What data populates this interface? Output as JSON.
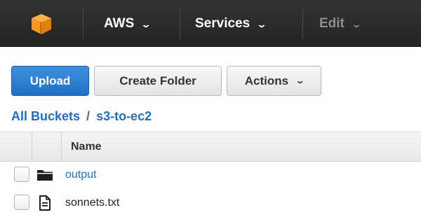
{
  "nav": {
    "logo_icon": "aws-cube-icon",
    "items": [
      {
        "label": "AWS",
        "caret": "⌄"
      },
      {
        "label": "Services",
        "caret": "⌄"
      },
      {
        "label": "Edit",
        "caret": "⌄",
        "disabled": true
      }
    ]
  },
  "toolbar": {
    "upload_label": "Upload",
    "create_folder_label": "Create Folder",
    "actions_label": "Actions",
    "actions_caret": "⌄"
  },
  "breadcrumb": {
    "root": "All Buckets",
    "separator": "/",
    "current": "s3-to-ec2"
  },
  "table": {
    "name_header": "Name",
    "rows": [
      {
        "name": "output",
        "type": "folder",
        "icon": "folder-icon"
      },
      {
        "name": "sonnets.txt",
        "type": "file",
        "icon": "file-text-icon"
      }
    ]
  },
  "colors": {
    "topbar": "#232323",
    "primary": "#1f6fc5",
    "logo": "#f7981d"
  }
}
